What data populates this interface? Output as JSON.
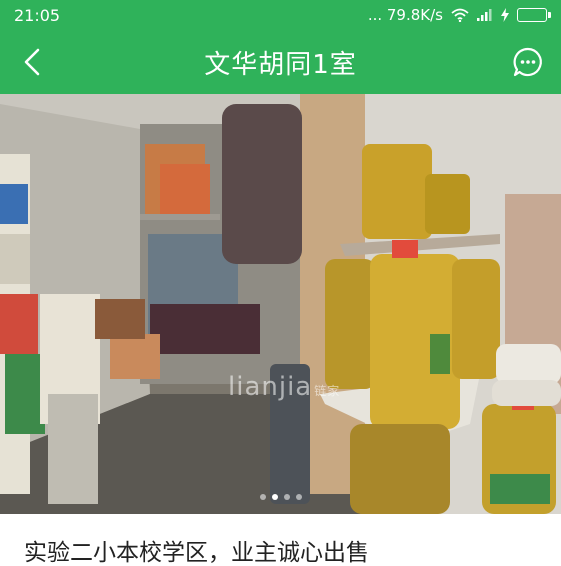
{
  "status_bar": {
    "time": "21:05",
    "network_speed": "... 79.8K/s",
    "battery_level": 1.0,
    "icons": [
      "wifi-icon",
      "signal-icon",
      "charging-bolt-icon",
      "battery-icon"
    ]
  },
  "nav": {
    "title": "文华胡同1室",
    "back_icon": "chevron-left-icon",
    "chat_icon": "chat-bubble-icon"
  },
  "photo": {
    "watermark": "lianjia",
    "watermark_sub": "链家",
    "page_count": 4,
    "active_page": 1
  },
  "listing": {
    "headline": "实验二小本校学区，业主诚心出售"
  },
  "colors": {
    "brand_green": "#2fb25a",
    "text_dark": "#222222"
  }
}
